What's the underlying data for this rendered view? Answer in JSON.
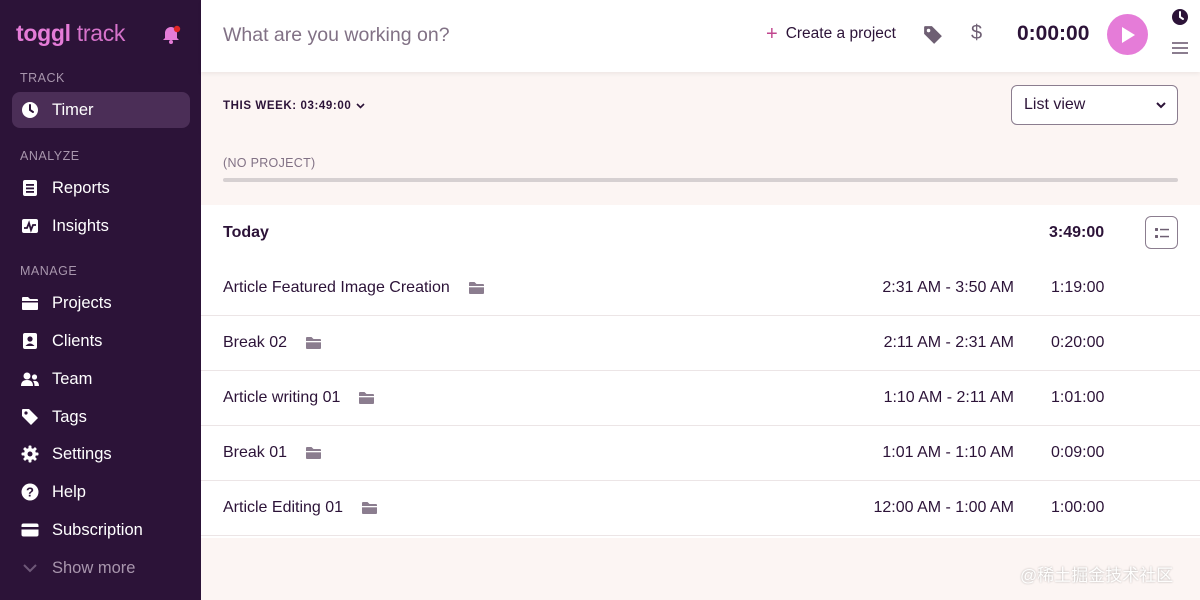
{
  "app": {
    "logo_brand": "toggl",
    "logo_product": " track"
  },
  "sidebar": {
    "sections": {
      "track": "TRACK",
      "analyze": "ANALYZE",
      "manage": "MANAGE"
    },
    "items": [
      {
        "label": "Timer",
        "icon": "clock-icon",
        "active": true
      },
      {
        "label": "Reports",
        "icon": "reports-icon"
      },
      {
        "label": "Insights",
        "icon": "insights-icon"
      },
      {
        "label": "Projects",
        "icon": "folder-icon"
      },
      {
        "label": "Clients",
        "icon": "client-icon"
      },
      {
        "label": "Team",
        "icon": "team-icon"
      },
      {
        "label": "Tags",
        "icon": "tag-icon"
      },
      {
        "label": "Settings",
        "icon": "gear-icon"
      },
      {
        "label": "Help",
        "icon": "help-icon"
      },
      {
        "label": "Subscription",
        "icon": "card-icon"
      }
    ],
    "show_more": "Show more"
  },
  "topbar": {
    "placeholder": "What are you working on?",
    "create_project": "Create a project",
    "timer": "0:00:00"
  },
  "week": {
    "total_label": "THIS WEEK: 03:49:00",
    "view_select": "List view"
  },
  "no_project_label": "(NO PROJECT)",
  "day": {
    "title": "Today",
    "total": "3:49:00"
  },
  "entries": [
    {
      "description": "Article Featured Image Creation",
      "range": "2:31 AM - 3:50 AM",
      "duration": "1:19:00"
    },
    {
      "description": "Break 02",
      "range": "2:11 AM - 2:31 AM",
      "duration": "0:20:00"
    },
    {
      "description": "Article writing 01",
      "range": "1:10 AM - 2:11 AM",
      "duration": "1:01:00"
    },
    {
      "description": "Break 01",
      "range": "1:01 AM - 1:10 AM",
      "duration": "0:09:00"
    },
    {
      "description": "Article Editing 01",
      "range": "12:00 AM - 1:00 AM",
      "duration": "1:00:00"
    }
  ],
  "watermark": "@稀土掘金技术社区",
  "colors": {
    "sidebar_bg": "#2c1338",
    "accent": "#e57cd8",
    "bell_badge": "#e02727"
  }
}
